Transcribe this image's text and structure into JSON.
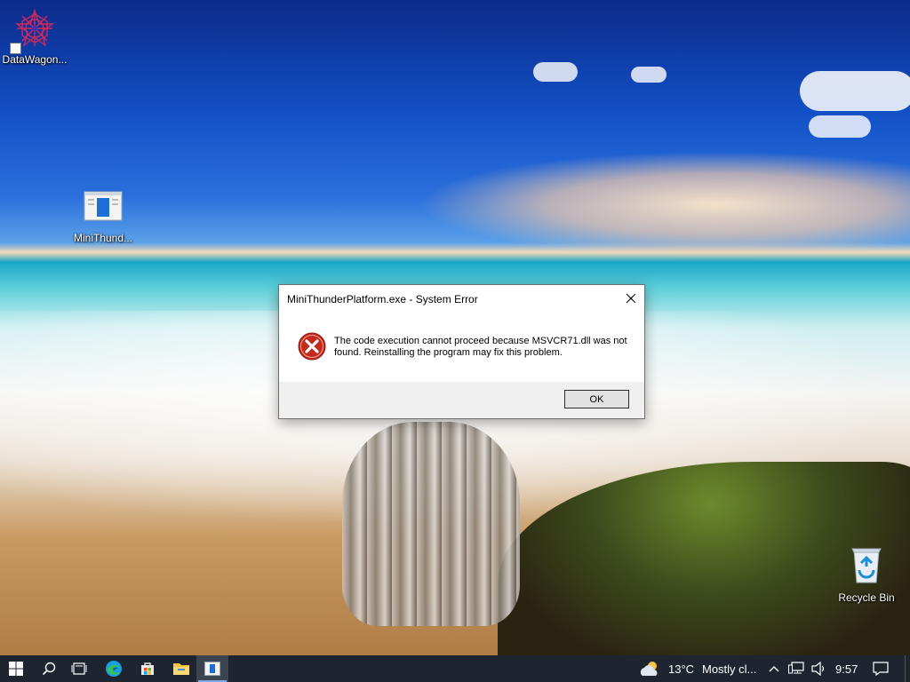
{
  "desktop": {
    "icons": [
      {
        "label": "DataWagon..."
      },
      {
        "label": "MiniThund..."
      },
      {
        "label": "Recycle Bin"
      }
    ]
  },
  "dialog": {
    "title": "MiniThunderPlatform.exe - System Error",
    "message": "The code execution cannot proceed because MSVCR71.dll was not found. Reinstalling the program may fix this problem.",
    "ok_label": "OK",
    "icon": "error-icon"
  },
  "taskbar": {
    "weather_temp": "13°C",
    "weather_text": "Mostly cl...",
    "clock": "9:57",
    "icons": [
      "windows-start-icon",
      "search-icon",
      "task-view-icon",
      "edge-icon",
      "store-icon",
      "file-explorer-icon",
      "app-window-icon"
    ]
  },
  "colors": {
    "taskbar_bg": "#1f2530",
    "dialog_footer_bg": "#f0f0f0",
    "error_red": "#c42b1c"
  }
}
